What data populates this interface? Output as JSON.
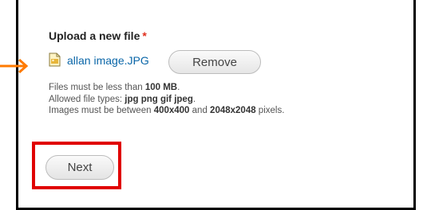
{
  "upload": {
    "title": "Upload a new file",
    "required_mark": "*",
    "file_name": "allan image.JPG",
    "remove_label": "Remove"
  },
  "help": {
    "line1_prefix": "Files must be less than ",
    "line1_value": "100 MB",
    "line1_suffix": ".",
    "line2_prefix": "Allowed file types: ",
    "line2_value": "jpg png gif jpeg",
    "line2_suffix": ".",
    "line3_prefix": "Images must be between ",
    "line3_min": "400x400",
    "line3_mid": " and ",
    "line3_max": "2048x2048",
    "line3_suffix": " pixels."
  },
  "actions": {
    "next_label": "Next"
  },
  "icons": {
    "pointer": "arrow-right-icon",
    "file": "image-file-icon"
  },
  "colors": {
    "highlight": "#e00000",
    "arrow": "#ff7a00",
    "link": "#0a66a8",
    "required": "#e0301e"
  }
}
